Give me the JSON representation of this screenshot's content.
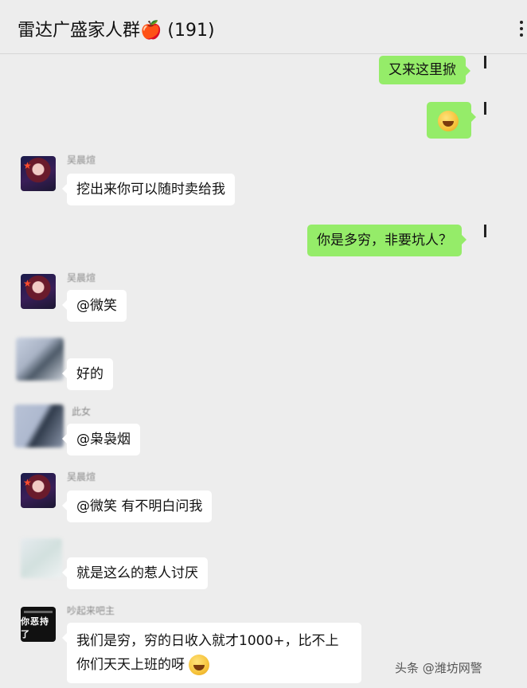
{
  "header": {
    "title": "雷达广盛家人群",
    "apple": "🍎",
    "count": "(191)"
  },
  "messages": [
    {
      "side": "out",
      "text": "又来这里掀"
    },
    {
      "side": "out",
      "emoji": "laughing-emoji"
    },
    {
      "side": "in",
      "sender": "吴晨煊",
      "text": "挖出来你可以随时卖给我"
    },
    {
      "side": "out",
      "text": "你是多穷，非要坑人？"
    },
    {
      "side": "in",
      "sender": "吴晨煊",
      "text": "@微笑"
    },
    {
      "side": "in",
      "sender": "",
      "text": "好的"
    },
    {
      "side": "in",
      "sender": "此女",
      "text": "@枭袅烟"
    },
    {
      "side": "in",
      "sender": "吴晨煊",
      "text": "@微笑 有不明白问我"
    },
    {
      "side": "in",
      "sender": "",
      "text": "就是这么的惹人讨厌"
    },
    {
      "side": "in",
      "sender": "吵起来吧主",
      "text_line1": "我们是穷，穷的日收入就才1000+，比不上",
      "text_line2": "你们天天上班的呀"
    }
  ],
  "avatar_text": "你恶持了",
  "watermark": "头条 @潍坊网警"
}
